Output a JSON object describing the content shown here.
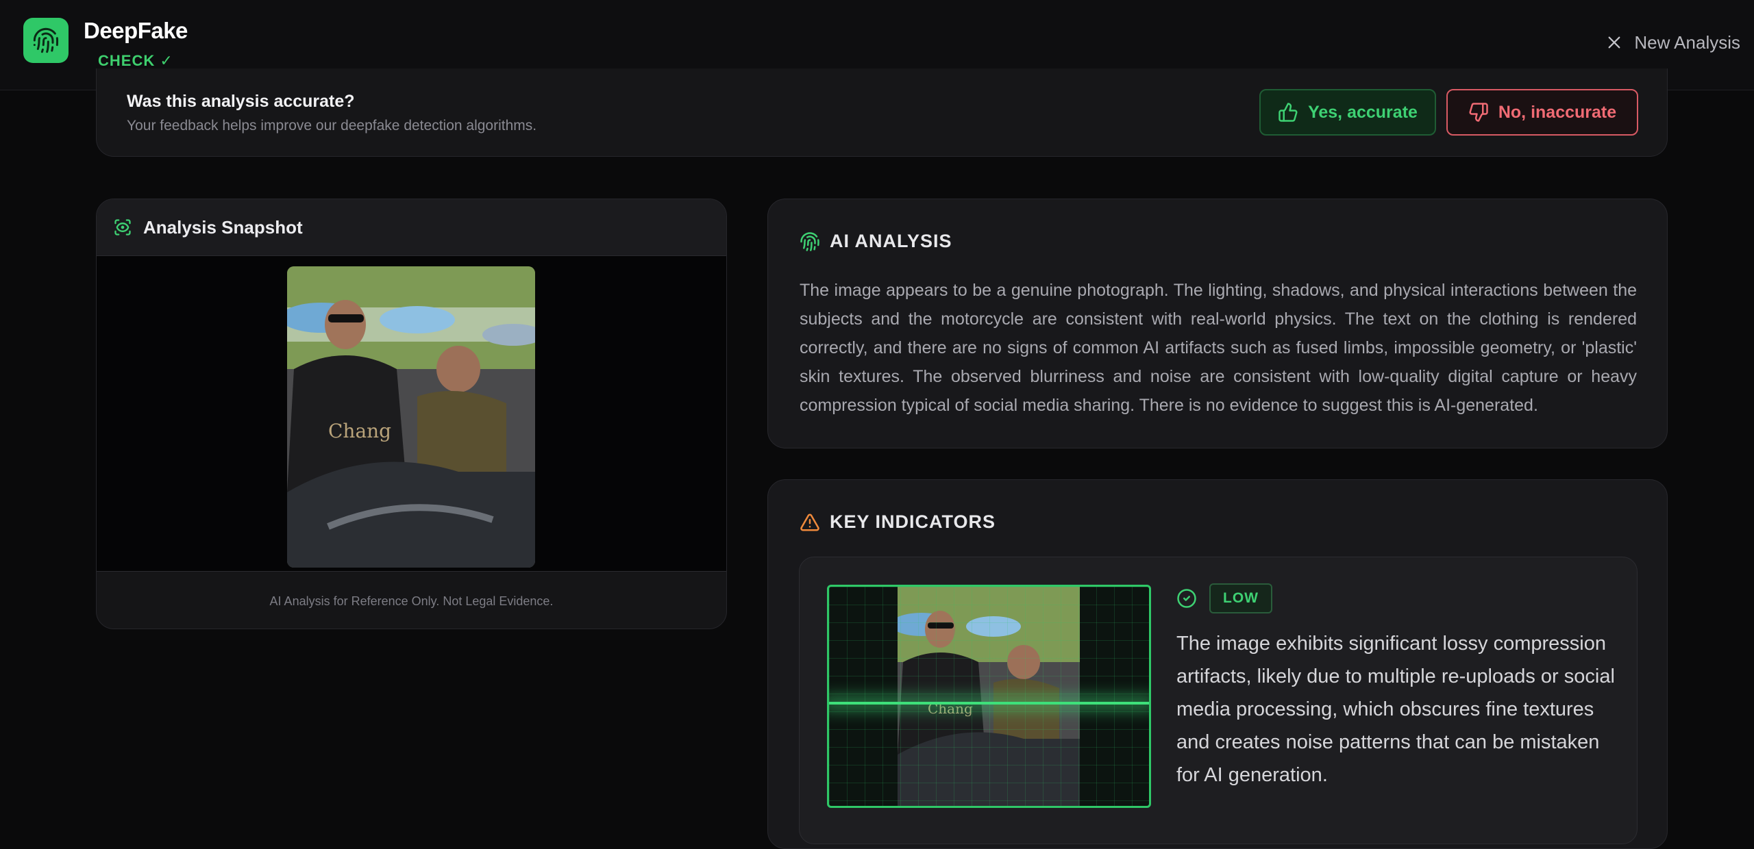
{
  "header": {
    "brand_name": "DeepFake",
    "brand_sub": "CHECK ✓",
    "new_analysis_label": "New Analysis"
  },
  "feedback": {
    "title": "Was this analysis accurate?",
    "subtitle": "Your feedback helps improve our deepfake detection algorithms.",
    "yes_label": "Yes, accurate",
    "no_label": "No, inaccurate"
  },
  "snapshot": {
    "title": "Analysis Snapshot",
    "footer": "AI Analysis for Reference Only. Not Legal Evidence."
  },
  "ai_analysis": {
    "title": "AI ANALYSIS",
    "text": "The image appears to be a genuine photograph. The lighting, shadows, and physical interactions between the subjects and the motorcycle are consistent with real-world physics. The text on the clothing is rendered correctly, and there are no signs of common AI artifacts such as fused limbs, impossible geometry, or 'plastic' skin textures. The observed blurriness and noise are consistent with low-quality digital capture or heavy compression typical of social media sharing. There is no evidence to suggest this is AI-generated."
  },
  "key_indicators": {
    "title": "KEY INDICATORS",
    "items": [
      {
        "severity": "LOW",
        "text": "The image exhibits significant lossy compression artifacts, likely due to multiple re-uploads or social media processing, which obscures fine textures and creates noise patterns that can be mistaken for AI generation."
      }
    ]
  },
  "colors": {
    "accent_green": "#2fc867",
    "danger_red": "#f06b74",
    "warning_orange": "#f08a3c",
    "background": "#0a0a0b"
  },
  "icons": {
    "logo": "fingerprint-icon",
    "close": "close-icon",
    "thumbs_up": "thumbs-up-icon",
    "thumbs_down": "thumbs-down-icon",
    "snapshot": "scan-eye-icon",
    "ai": "fingerprint-icon",
    "warning": "warning-icon",
    "check": "check-circle-icon"
  }
}
